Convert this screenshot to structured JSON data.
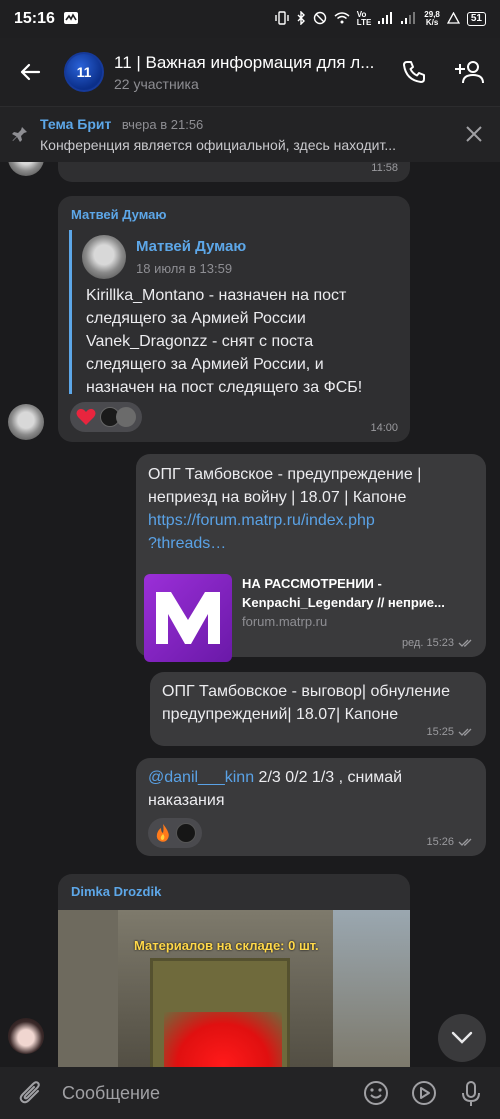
{
  "statusbar": {
    "time": "15:16",
    "speed_value": "29,8",
    "speed_unit": "K/s",
    "battery": "51"
  },
  "header": {
    "avatar_text": "11",
    "title": "11 | Важная информация для л...",
    "subtitle": "22 участника"
  },
  "pinned": {
    "author": "Тема Брит",
    "date": "вчера в 21:56",
    "text": "Конференция является официальной, здесь находит..."
  },
  "messages": {
    "m0": {
      "time": "11:58"
    },
    "m1": {
      "sender": "Матвей Думаю",
      "fwd_name": "Матвей Думаю",
      "fwd_date": "18 июля в 13:59",
      "lines": [
        "Kirillka_Montano - назначен на пост",
        "следящего за Армией России",
        "Vanek_Dragonzz - снят с поста",
        "следящего за Армией России, и",
        "назначен на пост следящего за ФСБ!"
      ],
      "time": "14:00"
    },
    "m2": {
      "lines": [
        "ОПГ Тамбовское - предупреждение |",
        "неприезд на войну | 18.07 | Капоне"
      ],
      "link_lines": [
        "https://forum.matrp.ru/index.php",
        "?threads…"
      ],
      "preview_title": "НА РАССМОТРЕНИИ -",
      "preview_sub": "Kenpachi_Legendary // неприе...",
      "preview_site": "forum.matrp.ru",
      "time": "ред. 15:23"
    },
    "m3": {
      "lines": [
        "ОПГ Тамбовское - выговор| обнуление",
        "предупреждений| 18.07| Капоне"
      ],
      "time": "15:25"
    },
    "m4": {
      "mention": "@danil___kinn",
      "line1_rest": " 2/3 0/2 1/3 , снимай",
      "line2": "наказания",
      "time": "15:26"
    },
    "m5": {
      "sender": "Dimka Drozdik",
      "image_caption": "Материалов на складе: 0 шт."
    }
  },
  "composer": {
    "placeholder": "Сообщение"
  },
  "icons": [
    "back-arrow-icon",
    "phone-icon",
    "add-user-icon",
    "pin-icon",
    "close-icon",
    "attach-icon",
    "emoji-icon",
    "play-icon",
    "mic-icon",
    "chevron-down-icon",
    "heart-reaction",
    "fire-reaction"
  ],
  "colors": {
    "accent": "#5da7e8",
    "link": "#5aa2e6",
    "bubble": "#2f2f31",
    "background": "#1b1b1d"
  }
}
